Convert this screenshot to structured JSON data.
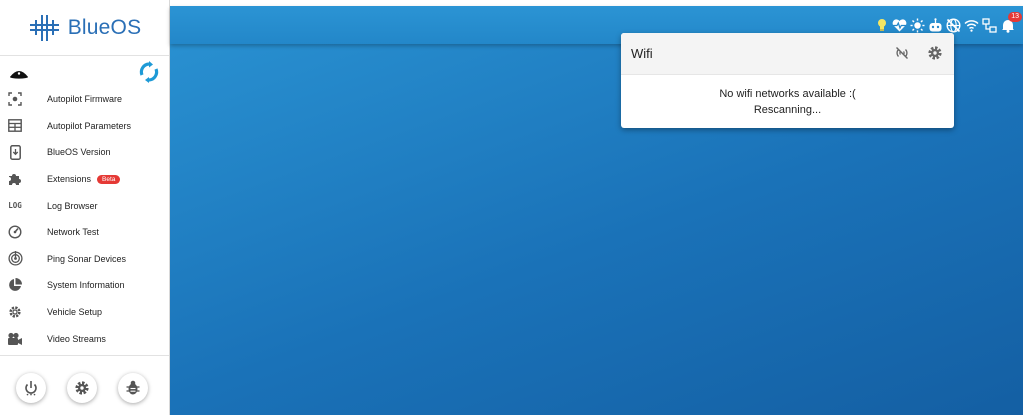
{
  "app": {
    "brand": "BlueOS"
  },
  "sidebar": {
    "items": [
      {
        "label": "Autopilot Firmware",
        "icon": "autopilot-firmware-icon"
      },
      {
        "label": "Autopilot Parameters",
        "icon": "table-icon"
      },
      {
        "label": "BlueOS Version",
        "icon": "phone-download-icon"
      },
      {
        "label": "Extensions",
        "icon": "puzzle-icon",
        "badge": "Beta"
      },
      {
        "label": "Log Browser",
        "icon": "log-icon",
        "icon_text": "LOG"
      },
      {
        "label": "Network Test",
        "icon": "speedometer-icon"
      },
      {
        "label": "Ping Sonar Devices",
        "icon": "sonar-icon"
      },
      {
        "label": "System Information",
        "icon": "pie-chart-icon"
      },
      {
        "label": "Vehicle Setup",
        "icon": "gear-icon"
      },
      {
        "label": "Video Streams",
        "icon": "video-camera-icon"
      }
    ],
    "footer_buttons": [
      "power-icon",
      "settings-icon",
      "bug-icon"
    ]
  },
  "topbar": {
    "tray_icons": [
      "light-bulb-icon",
      "heart-pulse-icon",
      "sun-icon",
      "robot-icon",
      "network-globe-icon",
      "wifi-icon",
      "ethernet-icon",
      "bell-icon"
    ],
    "notification_count": "13"
  },
  "wifi_panel": {
    "title": "Wifi",
    "message": "No wifi networks available :(",
    "status": "Rescanning..."
  },
  "colors": {
    "accent": "#2a6fb6",
    "background_blue": "#1a72b8",
    "badge_red": "#e53935",
    "reload_cyan": "#1e9ad6",
    "bulb_yellow": "#f5e663"
  }
}
